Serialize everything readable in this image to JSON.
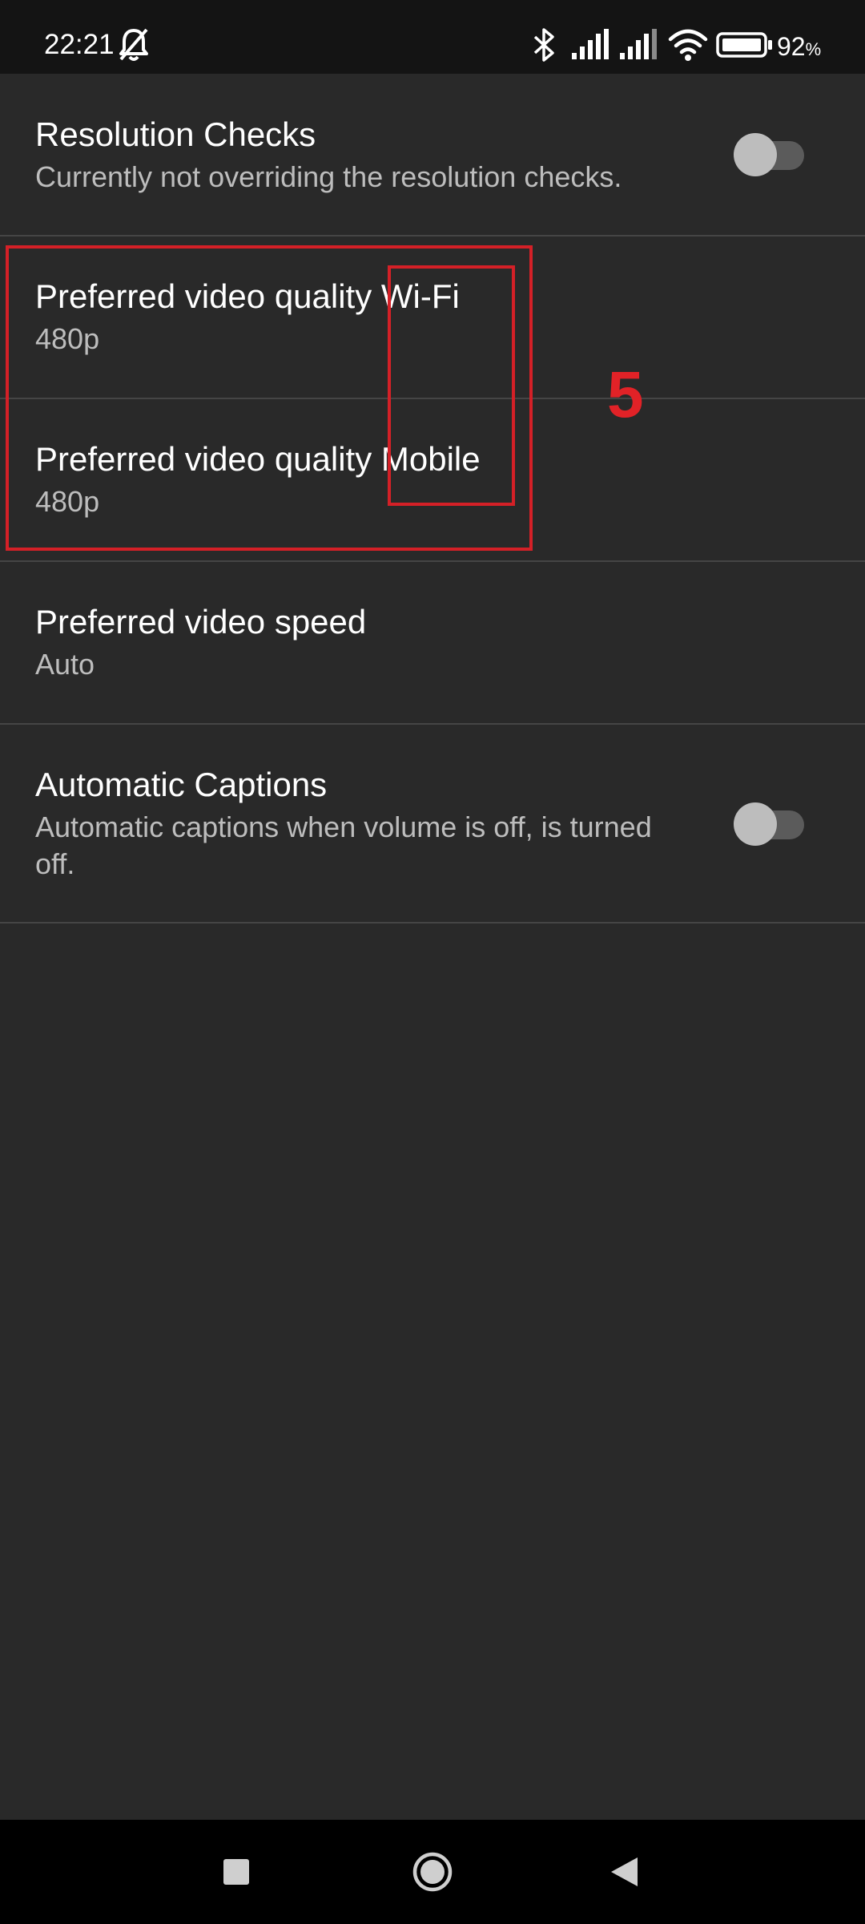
{
  "status_bar": {
    "time": "22:21",
    "battery_percent": "92",
    "battery_unit": "%",
    "icons": [
      "bell-off-icon",
      "bluetooth-icon",
      "signal-icon",
      "signal-icon",
      "wifi-icon",
      "battery-icon"
    ]
  },
  "settings": {
    "resolution_checks": {
      "title": "Resolution Checks",
      "summary": "Currently not overriding the resolution checks.",
      "enabled": false
    },
    "quality_wifi": {
      "title": "Preferred video quality Wi-Fi",
      "summary": "480p"
    },
    "quality_mobile": {
      "title": "Preferred video quality Mobile",
      "summary": "480p"
    },
    "video_speed": {
      "title": "Preferred video speed",
      "summary": "Auto"
    },
    "auto_captions": {
      "title": "Automatic Captions",
      "summary": "Automatic captions when volume is off, is turned off.",
      "enabled": false
    }
  },
  "annotation": {
    "label": "5",
    "color": "#d42027"
  },
  "nav_bar": {
    "icons": [
      "recents-square-icon",
      "home-circle-icon",
      "back-triangle-icon"
    ]
  },
  "colors": {
    "background": "#292929",
    "status_bar": "#141414",
    "text_primary": "#ffffff",
    "text_secondary": "#bdbdbd",
    "toggle_off_thumb": "#bdbdbd",
    "toggle_off_track": "#5b5b5b"
  }
}
